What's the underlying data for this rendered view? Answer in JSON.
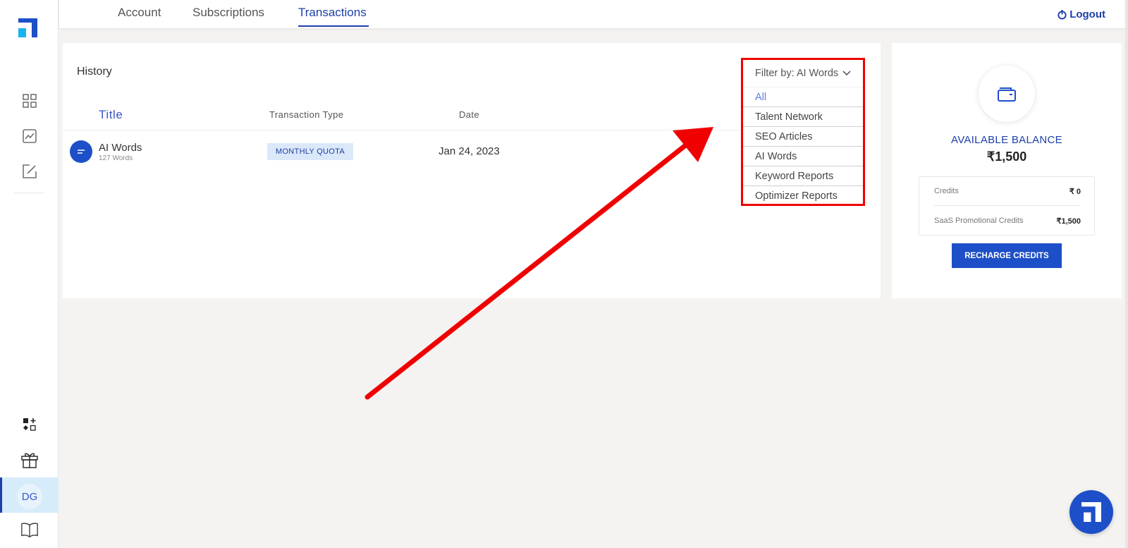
{
  "sidebar": {
    "items": [
      {
        "name": "dashboard-grid-icon"
      },
      {
        "name": "chart-icon"
      },
      {
        "name": "edit-icon"
      },
      {
        "name": "shapes-add-icon"
      },
      {
        "name": "gift-icon"
      },
      {
        "name": "book-icon"
      }
    ],
    "avatar_initials": "DG",
    "accent": "#1d3fa8"
  },
  "topbar": {
    "tabs": [
      {
        "label": "Account",
        "active": false
      },
      {
        "label": "Subscriptions",
        "active": false
      },
      {
        "label": "Transactions",
        "active": true
      }
    ],
    "logout_label": "Logout"
  },
  "history": {
    "title": "History",
    "columns": {
      "title": "Title",
      "type": "Transaction Type",
      "date": "Date"
    },
    "rows": [
      {
        "title": "AI Words",
        "subtitle": "127 Words",
        "type": "MONTHLY QUOTA",
        "date": "Jan 24, 2023"
      }
    ],
    "filter": {
      "label": "Filter by: AI Words",
      "options": [
        "All",
        "Talent Network",
        "SEO Articles",
        "AI Words",
        "Keyword Reports",
        "Optimizer Reports"
      ]
    }
  },
  "balance": {
    "label": "AVAILABLE BALANCE",
    "amount": "₹1,500",
    "credits": [
      {
        "label": "Credits",
        "value": "₹ 0"
      },
      {
        "label": "SaaS Promotional Credits",
        "value": "₹1,500"
      }
    ],
    "button_label": "RECHARGE CREDITS"
  },
  "colors": {
    "primary": "#1d4fc8",
    "annotation": "#f00000"
  }
}
